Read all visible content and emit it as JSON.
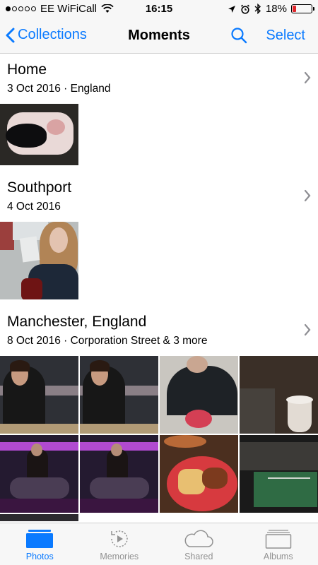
{
  "status_bar": {
    "carrier": "EE WiFiCall",
    "time": "16:15",
    "battery": "18%",
    "battery_level": 0.18,
    "signal_bars_filled": 1,
    "signal_bars_total": 5
  },
  "nav": {
    "back_label": "Collections",
    "title": "Moments",
    "select_label": "Select",
    "search_icon": "search-icon",
    "accent_color": "#0a7aff"
  },
  "moments": [
    {
      "title": "Home",
      "subtitle": "3 Oct 2016 · England",
      "photo_count": 1
    },
    {
      "title": "Southport",
      "subtitle": "4 Oct 2016",
      "photo_count": 1
    },
    {
      "title": "Manchester, England",
      "subtitle": "8 Oct 2016 · Corporation Street & 3 more",
      "photo_count": 8
    }
  ],
  "tab_bar": {
    "tabs": [
      {
        "label": "Photos",
        "icon": "photos-icon",
        "active": true
      },
      {
        "label": "Memories",
        "icon": "memories-icon",
        "active": false
      },
      {
        "label": "Shared",
        "icon": "shared-cloud-icon",
        "active": false
      },
      {
        "label": "Albums",
        "icon": "albums-icon",
        "active": false
      }
    ]
  }
}
